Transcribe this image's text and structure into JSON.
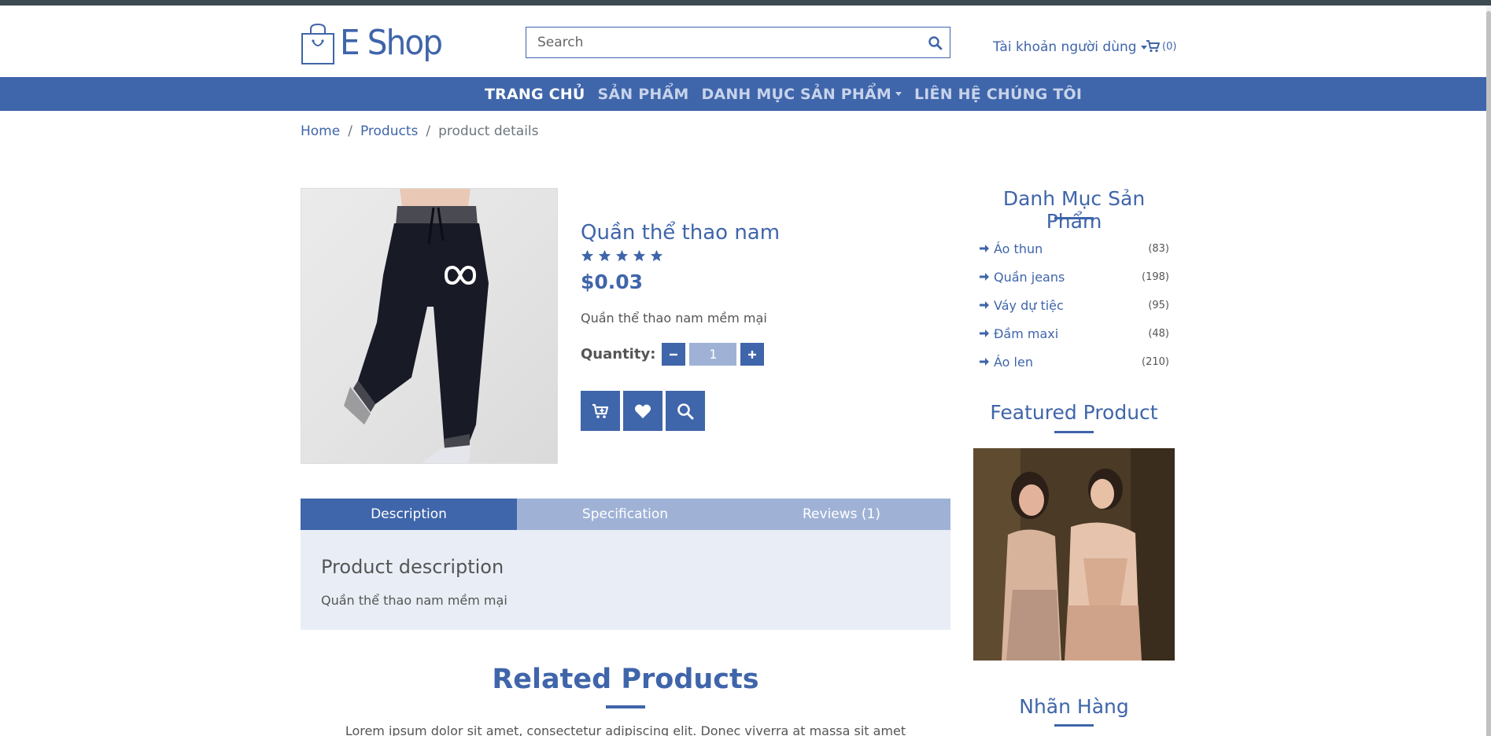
{
  "header": {
    "logo_text": "E Shop",
    "search_placeholder": "Search",
    "account_label": "Tài khoản người dùng",
    "cart_count": "(0)"
  },
  "nav": {
    "items": [
      {
        "label": "TRANG CHỦ",
        "active": true
      },
      {
        "label": "SẢN PHẨM"
      },
      {
        "label": "DANH MỤC SẢN PHẨM",
        "dropdown": true
      },
      {
        "label": "LIÊN HỆ CHÚNG TÔI"
      }
    ]
  },
  "breadcrumb": {
    "items": [
      "Home",
      "Products",
      "product details"
    ],
    "separator": "/"
  },
  "product": {
    "image_alt": "INFINITE",
    "title": "Quần thể thao nam",
    "rating": 5,
    "price": "$0.03",
    "short_description": "Quần thể thao nam mềm mại",
    "quantity_label": "Quantity:",
    "quantity_value": "1"
  },
  "tabs": {
    "items": [
      "Description",
      "Specification",
      "Reviews (1)"
    ],
    "active_index": 0,
    "panel_title": "Product description",
    "panel_text": "Quần thể thao nam mềm mại"
  },
  "related": {
    "title": "Related Products",
    "text": "Lorem ipsum dolor sit amet, consectetur adipiscing elit. Donec viverra at massa sit amet"
  },
  "sidebar": {
    "categories_title": "Danh Mục Sản Phẩm",
    "categories": [
      {
        "label": "Áo thun",
        "count": "(83)"
      },
      {
        "label": "Quần jeans",
        "count": "(198)"
      },
      {
        "label": "Váy dự tiệc",
        "count": "(95)"
      },
      {
        "label": "Đầm maxi",
        "count": "(48)"
      },
      {
        "label": "Áo len",
        "count": "(210)"
      }
    ],
    "featured_title": "Featured Product",
    "brands_title": "Nhãn Hàng"
  },
  "colors": {
    "primary": "#3f65aa",
    "primary_light": "#9fb2d6",
    "panel_bg": "#e9eef6",
    "top_strip": "#3e4a52"
  },
  "icons": {
    "search": "search-icon",
    "cart": "cart-icon",
    "star": "star-icon",
    "arrow": "arrow-right-icon",
    "minus": "minus-icon",
    "plus": "plus-icon",
    "add_to_cart": "cart-plus-icon",
    "heart": "heart-icon",
    "zoom": "search-icon"
  }
}
